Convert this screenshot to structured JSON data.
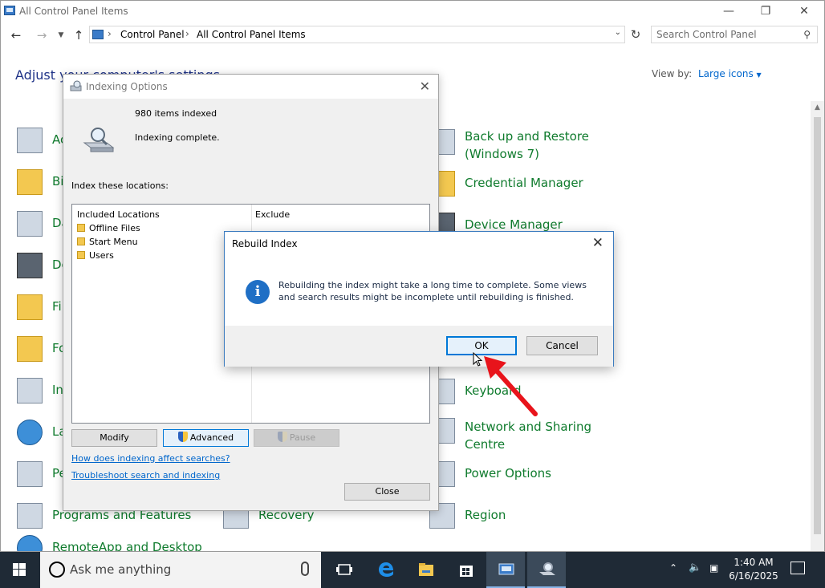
{
  "cp": {
    "window_title": "All Control Panel Items",
    "breadcrumb": [
      "Control Panel",
      "All Control Panel Items"
    ],
    "search_placeholder": "Search Control Panel",
    "heading": "Adjust your computer's settings",
    "view_by_label": "View by:",
    "view_by_value": "Large icons",
    "left_items": [
      "Ac",
      "Bi",
      "Da",
      "De",
      "Fi",
      "Fo",
      "In",
      "La",
      "Pe"
    ],
    "items": [
      {
        "label": "Programs and Features"
      },
      {
        "label": "Recovery"
      },
      {
        "label": "Region"
      },
      {
        "label": "RemoteApp and Desktop"
      },
      {
        "label": "Back up and Restore (Windows 7)"
      },
      {
        "label": "Credential Manager"
      },
      {
        "label": "Device Manager"
      },
      {
        "label": "Keyboard"
      },
      {
        "label": "Network and Sharing Centre"
      },
      {
        "label": "Power Options"
      }
    ]
  },
  "indexing": {
    "title": "Indexing Options",
    "count": "980 items indexed",
    "status": "Indexing complete.",
    "locations_label": "Index these locations:",
    "col_included": "Included Locations",
    "col_exclude": "Exclude",
    "locations": [
      "Offline Files",
      "Start Menu",
      "Users"
    ],
    "btn_modify": "Modify",
    "btn_advanced": "Advanced",
    "btn_pause": "Pause",
    "link_affect": "How does indexing affect searches?",
    "link_troubleshoot": "Troubleshoot search and indexing",
    "btn_close": "Close"
  },
  "rebuild": {
    "title": "Rebuild Index",
    "message": "Rebuilding the index might take a long time to complete. Some views and search results might be incomplete until rebuilding is finished.",
    "ok": "OK",
    "cancel": "Cancel"
  },
  "taskbar": {
    "search_text": "Ask me anything",
    "time": "1:40 AM",
    "date": "6/16/2025"
  },
  "colors": {
    "accent": "#0078d7",
    "link_green": "#0f7b2d",
    "taskbar": "#1f2a36",
    "arrow": "#e8141b"
  }
}
